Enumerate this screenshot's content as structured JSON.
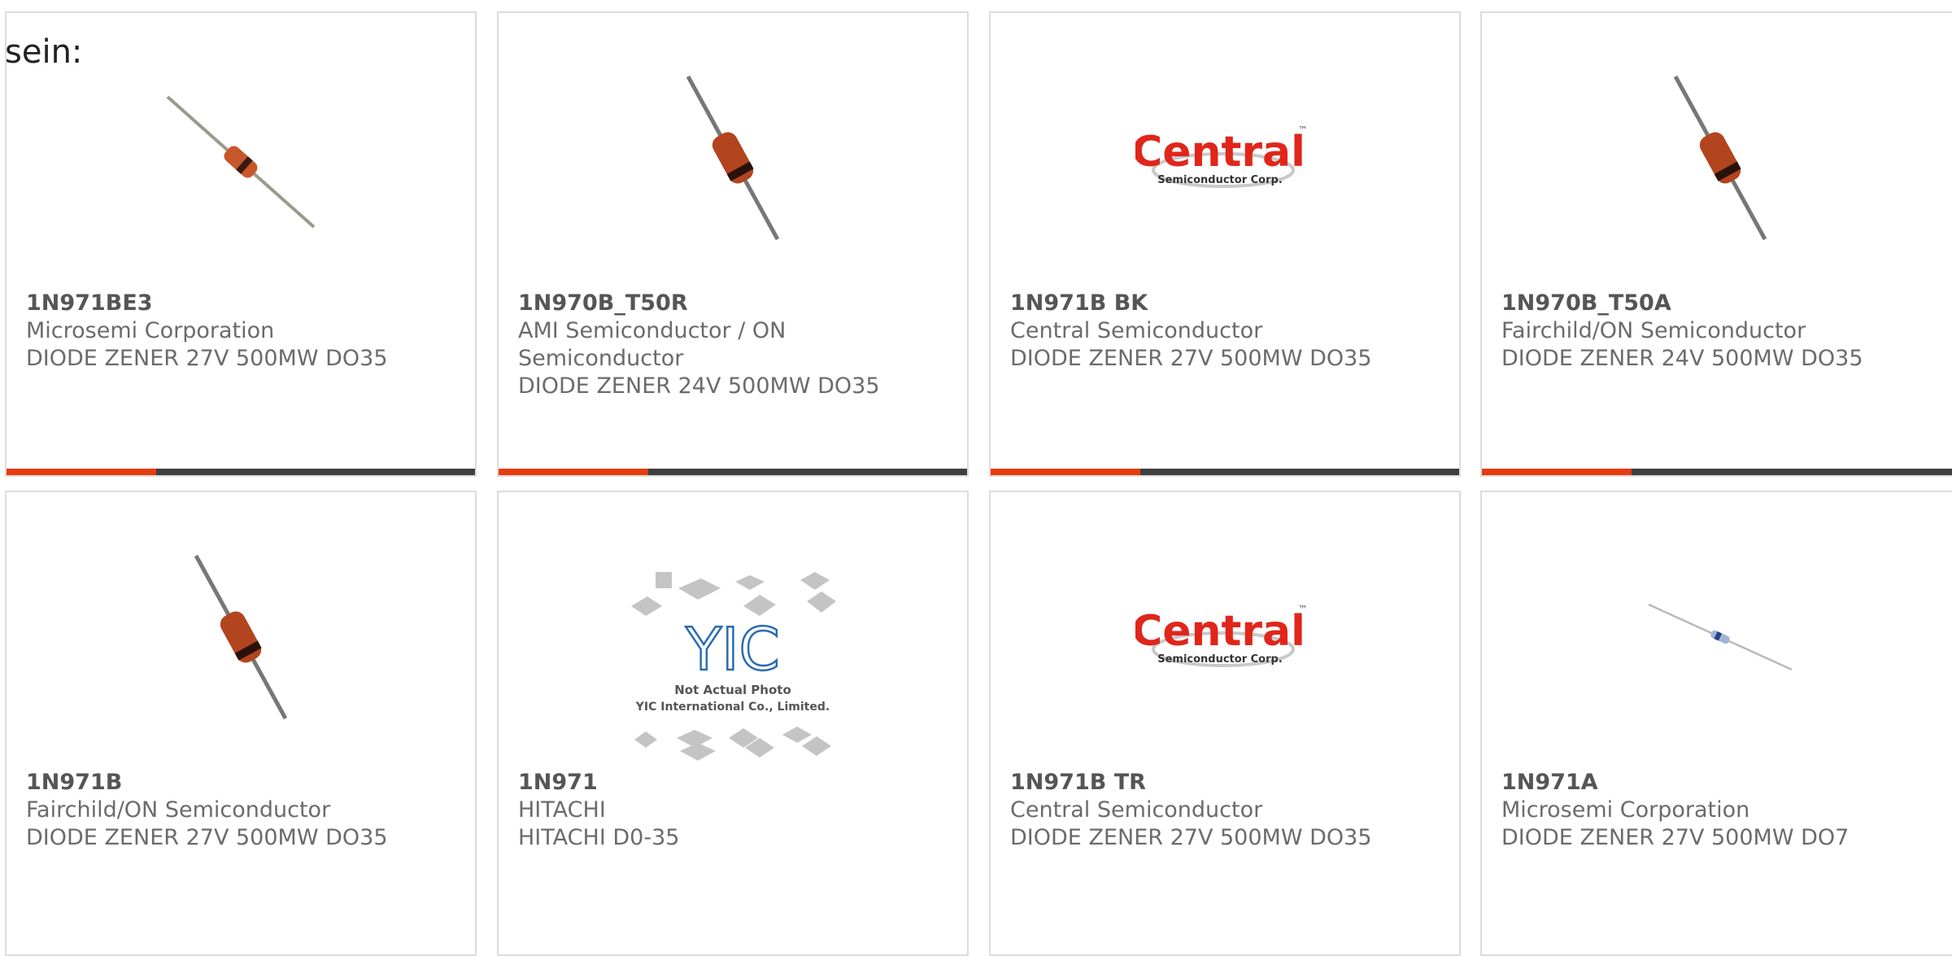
{
  "intro_text": "sein:",
  "colors": {
    "accent": "#e63c0e",
    "bar": "#3f3f3f",
    "border": "#dcdcdc",
    "text": "#6b6b6b"
  },
  "products": [
    {
      "part": "1N971BE3",
      "maker": "Microsemi Corporation",
      "desc": "DIODE ZENER 27V 500MW DO35",
      "image": "diode-diagonal-icon"
    },
    {
      "part": "1N970B_T50R",
      "maker": "AMI Semiconductor / ON Semiconductor",
      "desc": "DIODE ZENER 24V 500MW DO35",
      "image": "diode-steep-icon"
    },
    {
      "part": "1N971B BK",
      "maker": "Central Semiconductor",
      "desc": "DIODE ZENER 27V 500MW DO35",
      "image": "central-logo"
    },
    {
      "part": "1N970B_T50A",
      "maker": "Fairchild/ON Semiconductor",
      "desc": "DIODE ZENER 24V 500MW DO35",
      "image": "diode-steep-icon"
    },
    {
      "part": "1N971B",
      "maker": "Fairchild/ON Semiconductor",
      "desc": "DIODE ZENER 27V 500MW DO35",
      "image": "diode-steep-icon"
    },
    {
      "part": "1N971",
      "maker": "HITACHI",
      "desc": "HITACHI D0-35",
      "image": "yic-placeholder"
    },
    {
      "part": "1N971B TR",
      "maker": "Central Semiconductor",
      "desc": "DIODE ZENER 27V 500MW DO35",
      "image": "central-logo"
    },
    {
      "part": "1N971A",
      "maker": "Microsemi Corporation",
      "desc": "DIODE ZENER 27V 500MW DO7",
      "image": "glass-diode-icon"
    }
  ],
  "central_logo": {
    "word": "Central",
    "tm": "™",
    "sub": "Semiconductor Corp."
  },
  "yic_placeholder": {
    "mark": "YIC",
    "line1": "Not Actual Photo",
    "line2": "YIC International Co., Limited."
  }
}
